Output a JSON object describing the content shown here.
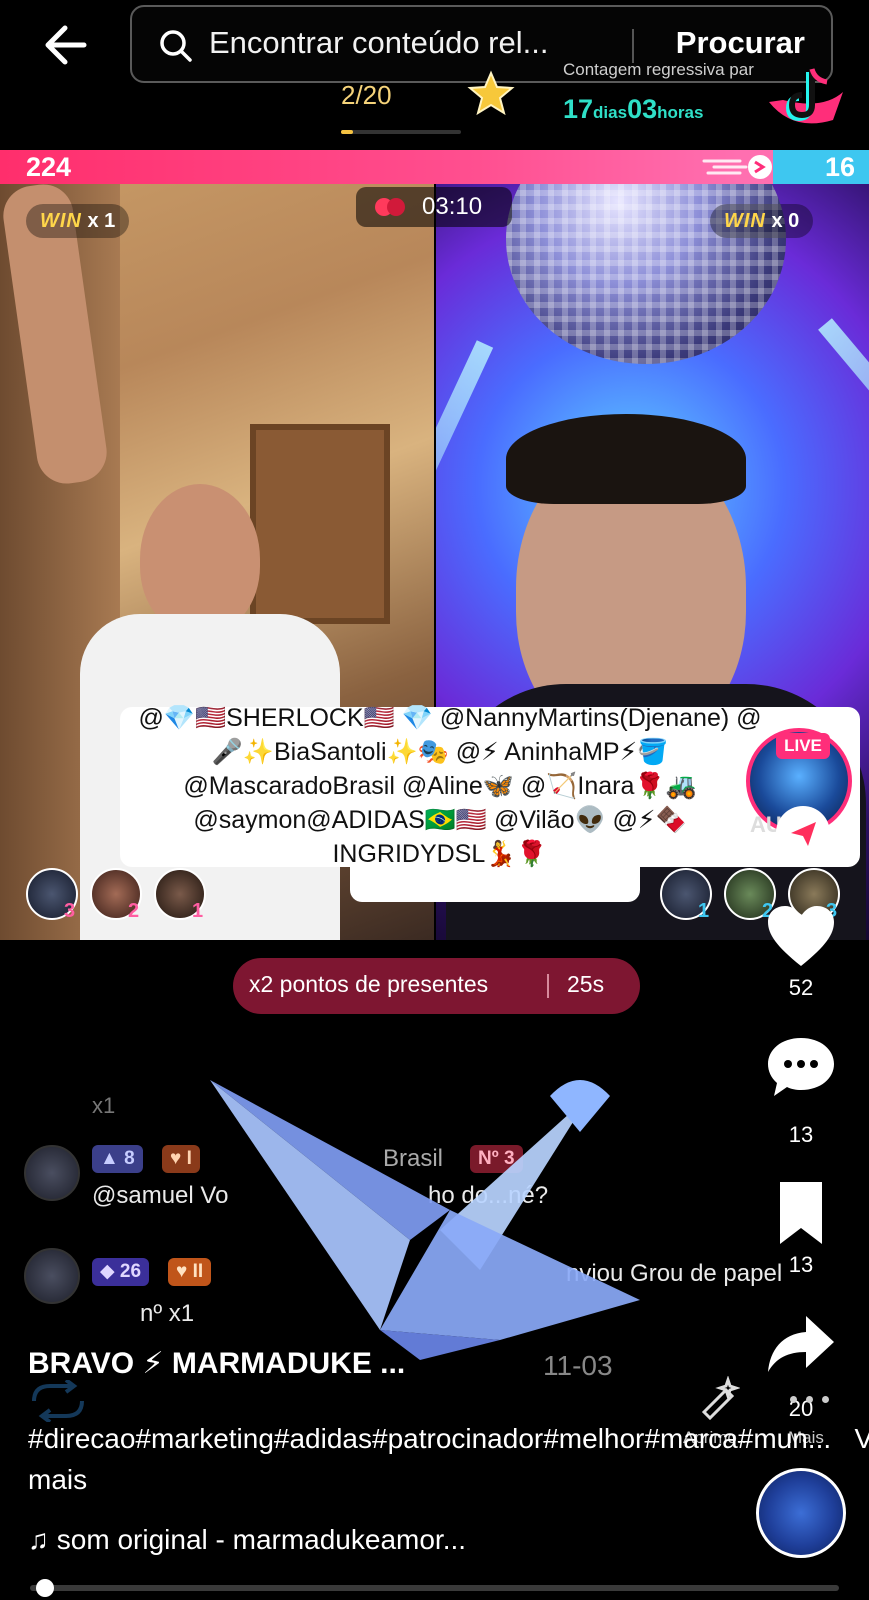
{
  "search": {
    "placeholder": "Encontrar conteúdo rel...",
    "button": "Procurar"
  },
  "battle": {
    "countdown_label": "Contagem regressiva par",
    "round": "2/20",
    "round_progress": 0.1,
    "countdown_days": "17",
    "countdown_days_unit": "dias",
    "countdown_hours": "03",
    "countdown_hours_unit": "horas",
    "score_left": "224",
    "score_right": "16",
    "timer": "03:10",
    "win_left_label": "WIN",
    "win_left_count": "x 1",
    "win_right_label": "WIN",
    "win_right_count": "x 0"
  },
  "mentions": [
    "@💎🇺🇸SHERLOCK🇺🇸 💎 @NannyMartins(Djenane) @",
    "🎤✨BiaSantoli✨🎭 @⚡ AninhaMP⚡🪣",
    "@MascaradoBrasil @Aline🦋 @🏹Inara🌹🚜",
    "@saymon@ADIDAS🇧🇷🇺🇸 @Vilão👽 @⚡🍫",
    "INGRIDYDSL💃🌹"
  ],
  "live": {
    "badge": "LIVE",
    "overlay_text": "AU"
  },
  "supporters": {
    "left_ranks": [
      "3",
      "2",
      "1"
    ],
    "right_ranks": [
      "1",
      "2",
      "3"
    ]
  },
  "multiplier": {
    "text": "x2 pontos de presentes",
    "time": "25s"
  },
  "comments": {
    "faded_top": "x1",
    "row1": {
      "level": "8",
      "fan_level": "I",
      "partial_name": "Brasil",
      "rank": "Nº 3",
      "text": "@samuel Vo",
      "text_tail": "ho do...né?"
    },
    "row2": {
      "level": "26",
      "fan_level": "II",
      "text": "nviou Grou de papel",
      "sub": "nº x1"
    }
  },
  "sidebar": {
    "likes": "52",
    "comments": "13",
    "saves": "13",
    "shares": "20"
  },
  "post": {
    "title": "BRAVO ⚡ MARMADUKE ...",
    "date": "11-03",
    "hashtags": "#direcao#marketing#adidas#patrocinador#melhor#marca#mun...",
    "see_more": "Ver mais",
    "sound": "som original - marmadukeamor...",
    "progress": 0.01
  },
  "toolbar": {
    "enhance_label": "Aprimo...",
    "more_label": "Mais"
  },
  "colors": {
    "score_pink": "#ff3a78",
    "score_blue": "#3ec7f0",
    "countdown_teal": "#2fe0c8",
    "round_gold": "#f5d37a",
    "multiplier_bg": "#7e1631",
    "live_pink": "#ff2e7a"
  },
  "icons": [
    "back-arrow-icon",
    "search-icon",
    "star-icon",
    "tiktok-logo-icon",
    "speed-icon",
    "vs-gloves-icon",
    "heart-icon",
    "comment-icon",
    "bookmark-icon",
    "share-icon",
    "paper-crane-icon",
    "music-note-icon"
  ]
}
